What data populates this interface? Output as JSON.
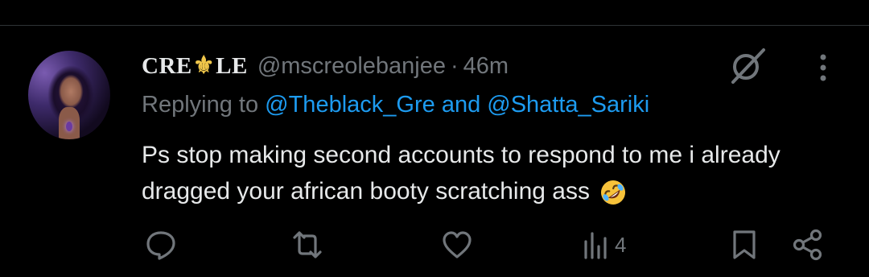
{
  "tweet": {
    "display_name_part1": "CRE",
    "display_name_symbol": "⚜",
    "display_name_part2": "LE",
    "handle": "@mscreolebanjee",
    "separator": "·",
    "time": "46m",
    "replying_prefix": "Replying to",
    "mention_1": "@Theblack_Gre",
    "conjunction": "and",
    "mention_2": "@Shatta_Sariki",
    "text": "Ps stop making second accounts to respond to me i already dragged your african booty scratching ass",
    "emoji_name": "rolling-on-floor-laughing"
  },
  "actions": {
    "views_count": "4"
  },
  "icons": [
    "grok-icon",
    "more-icon",
    "reply-icon",
    "retweet-icon",
    "like-icon",
    "views-icon",
    "bookmark-icon",
    "share-icon"
  ],
  "colors": {
    "background": "#000000",
    "text": "#e7e9ea",
    "secondary": "#71767b",
    "mention": "#1d9bf0",
    "gold": "#f0c64a"
  }
}
